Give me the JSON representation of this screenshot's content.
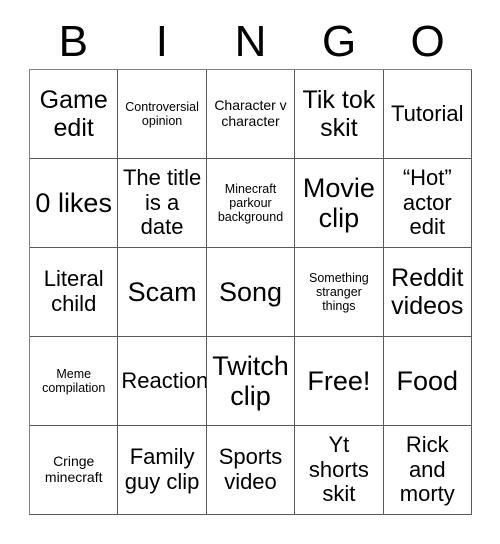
{
  "card": {
    "title": "BINGO",
    "header_letters": [
      "B",
      "I",
      "N",
      "G",
      "O"
    ],
    "columns": 5,
    "rows": 5,
    "colors": {
      "background": "#ffffff",
      "text": "#000000",
      "grid_line": "#595959"
    },
    "grid": [
      [
        {
          "text": "Game edit",
          "size": "lg"
        },
        {
          "text": "Controversial opinion",
          "size": "xs"
        },
        {
          "text": "Character v character",
          "size": "sm"
        },
        {
          "text": "Tik tok skit",
          "size": "lg"
        },
        {
          "text": "Tutorial",
          "size": "md"
        }
      ],
      [
        {
          "text": "0 likes",
          "size": "xl"
        },
        {
          "text": "The title is a date",
          "size": "md"
        },
        {
          "text": "Minecraft parkour background",
          "size": "xs"
        },
        {
          "text": "Movie clip",
          "size": "xl"
        },
        {
          "text": "“Hot” actor edit",
          "size": "md"
        }
      ],
      [
        {
          "text": "Literal child",
          "size": "md"
        },
        {
          "text": "Scam",
          "size": "xl"
        },
        {
          "text": "Song",
          "size": "xl"
        },
        {
          "text": "Something stranger things",
          "size": "xs"
        },
        {
          "text": "Reddit videos",
          "size": "lg"
        }
      ],
      [
        {
          "text": "Meme compilation",
          "size": "xs"
        },
        {
          "text": "Reaction",
          "size": "md"
        },
        {
          "text": "Twitch clip",
          "size": "xl"
        },
        {
          "text": "Free!",
          "size": "xl"
        },
        {
          "text": "Food",
          "size": "xl"
        }
      ],
      [
        {
          "text": "Cringe minecraft",
          "size": "sm"
        },
        {
          "text": "Family guy clip",
          "size": "md"
        },
        {
          "text": "Sports video",
          "size": "md"
        },
        {
          "text": "Yt shorts skit",
          "size": "md"
        },
        {
          "text": "Rick and morty",
          "size": "md"
        }
      ]
    ]
  }
}
